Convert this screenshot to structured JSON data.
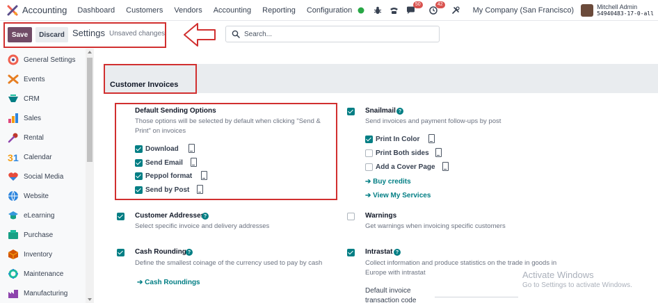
{
  "navbar": {
    "app_title": "Accounting",
    "menu": [
      "Dashboard",
      "Customers",
      "Vendors",
      "Accounting",
      "Reporting",
      "Configuration"
    ],
    "messages_count": "50",
    "activities_count": "42",
    "company": "My Company (San Francisco)",
    "user_name": "Mitchell Admin",
    "user_db": "54940483-17-0-all"
  },
  "control": {
    "save_label": "Save",
    "discard_label": "Discard",
    "title": "Settings",
    "unsaved": "Unsaved changes",
    "search_placeholder": "Search..."
  },
  "sidebar": {
    "items": [
      {
        "label": "General Settings",
        "color": "#f06050"
      },
      {
        "label": "Events",
        "color": "#e67e22"
      },
      {
        "label": "CRM",
        "color": "#017e84"
      },
      {
        "label": "Sales",
        "color": "#e0467c"
      },
      {
        "label": "Rental",
        "color": "#c0392b"
      },
      {
        "label": "Calendar",
        "color": "#f39c12"
      },
      {
        "label": "Social Media",
        "color": "#e74c3c"
      },
      {
        "label": "Website",
        "color": "#2e86de"
      },
      {
        "label": "eLearning",
        "color": "#3498db"
      },
      {
        "label": "Purchase",
        "color": "#16a085"
      },
      {
        "label": "Inventory",
        "color": "#d35400"
      },
      {
        "label": "Maintenance",
        "color": "#1abc9c"
      },
      {
        "label": "Manufacturing",
        "color": "#8e44ad"
      }
    ]
  },
  "section": {
    "title": "Customer Invoices"
  },
  "sending": {
    "title": "Default Sending Options",
    "desc": "Those options will be selected by default when clicking \"Send & Print\" on invoices",
    "options": [
      {
        "label": "Download",
        "checked": true
      },
      {
        "label": "Send Email",
        "checked": true
      },
      {
        "label": "Peppol format",
        "checked": true
      },
      {
        "label": "Send by Post",
        "checked": true
      }
    ]
  },
  "snailmail": {
    "title": "Snailmail",
    "desc": "Send invoices and payment follow-ups by post",
    "checked": true,
    "options": [
      {
        "label": "Print In Color",
        "checked": true
      },
      {
        "label": "Print Both sides",
        "checked": false
      },
      {
        "label": "Add a Cover Page",
        "checked": false
      }
    ],
    "links": [
      "Buy credits",
      "View My Services"
    ]
  },
  "customer_addresses": {
    "title": "Customer Addresses",
    "desc": "Select specific invoice and delivery addresses",
    "checked": true
  },
  "warnings": {
    "title": "Warnings",
    "desc": "Get warnings when invoicing specific customers",
    "checked": false
  },
  "cash_rounding": {
    "title": "Cash Rounding",
    "desc": "Define the smallest coinage of the currency used to pay by cash",
    "checked": true,
    "link": "Cash Roundings"
  },
  "intrastat": {
    "title": "Intrastat",
    "desc": "Collect information and produce statistics on the trade in goods in Europe with intrastat",
    "checked": true,
    "field_label": "Default invoice transaction code"
  },
  "watermark": {
    "title": "Activate Windows",
    "subtitle": "Go to Settings to activate Windows."
  }
}
